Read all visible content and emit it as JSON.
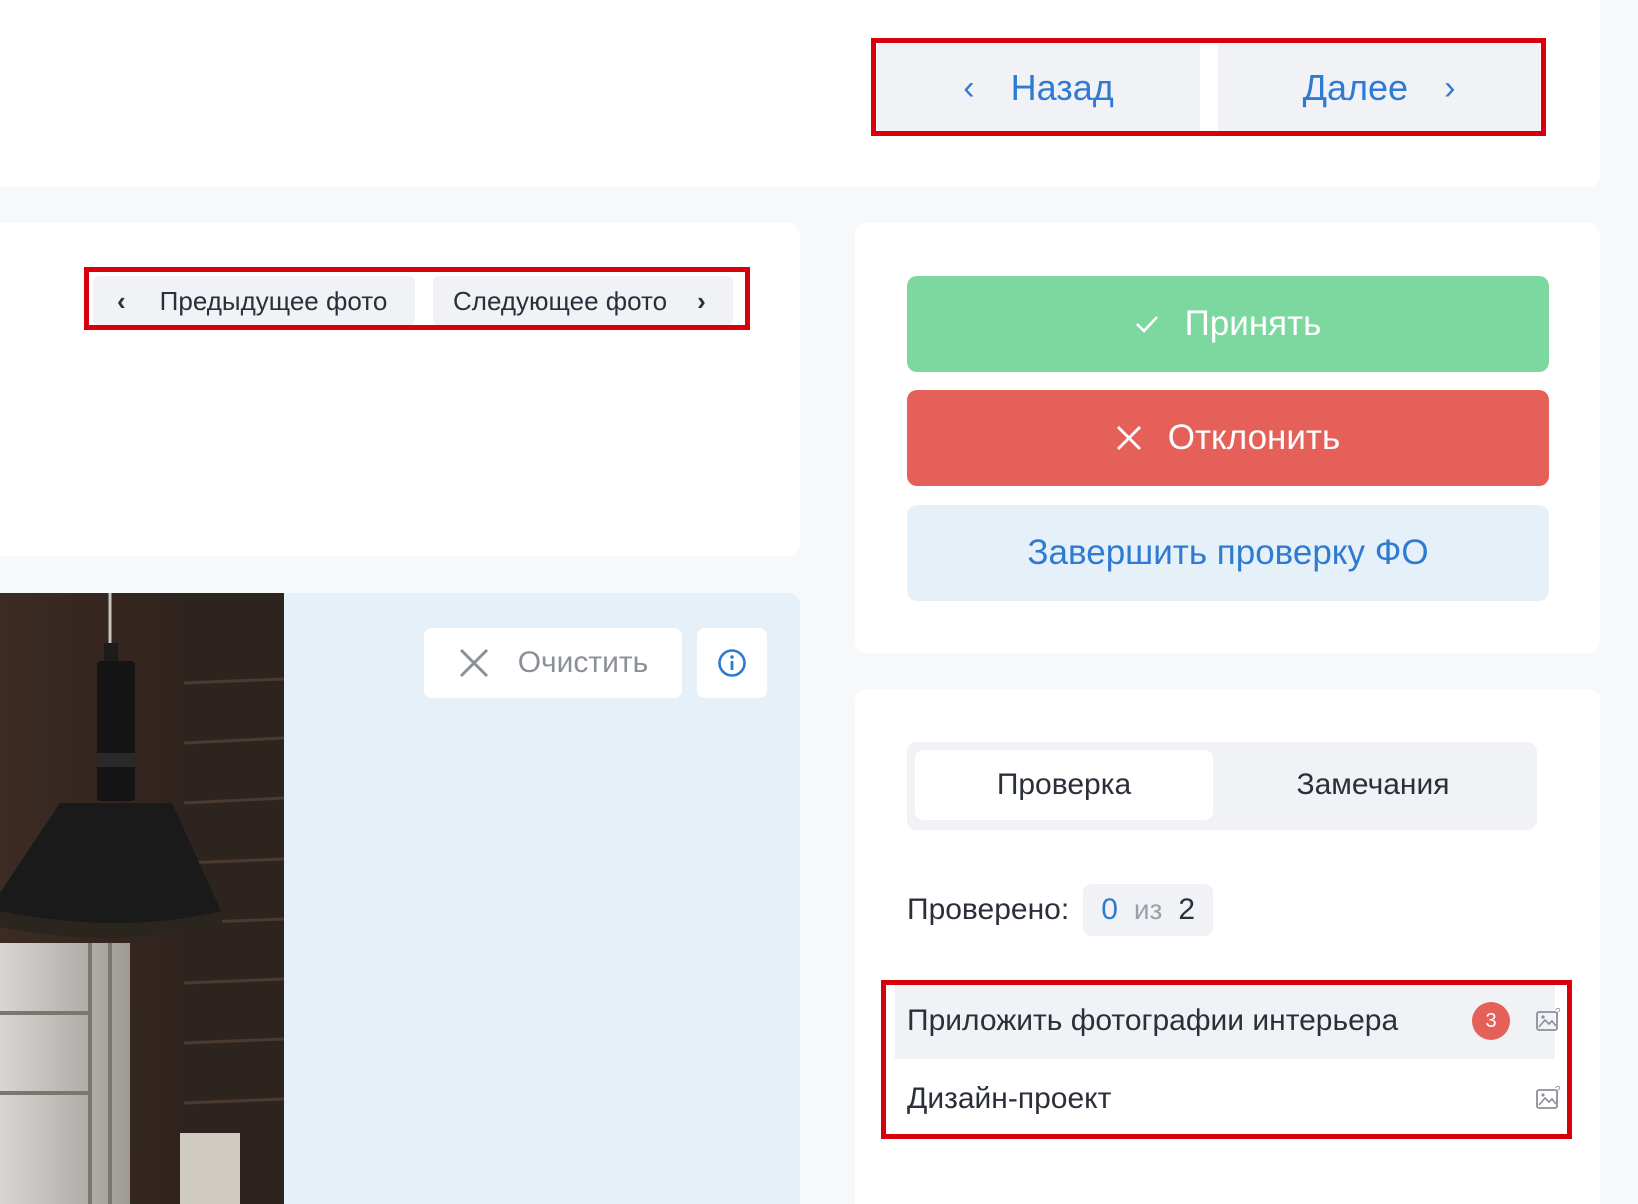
{
  "header": {
    "back_label": "Назад",
    "next_label": "Далее"
  },
  "photo_nav": {
    "prev_label": "Предыдущее фото",
    "next_label": "Следующее фото"
  },
  "image_toolbar": {
    "clear_label": "Очистить"
  },
  "actions": {
    "accept_label": "Принять",
    "reject_label": "Отклонить",
    "finish_label": "Завершить проверку ФО"
  },
  "tabs": [
    {
      "label": "Проверка",
      "active": true
    },
    {
      "label": "Замечания",
      "active": false
    }
  ],
  "progress": {
    "label": "Проверено:",
    "done": "0",
    "separator": "из",
    "total": "2"
  },
  "check_items": [
    {
      "label": "Приложить фотографии интерьера",
      "badge": "3"
    },
    {
      "label": "Дизайн-проект",
      "badge": ""
    }
  ],
  "colors": {
    "accent": "#2f7bd3",
    "accept": "#7dd89f",
    "reject": "#e6605a",
    "highlight": "#d9000d"
  }
}
